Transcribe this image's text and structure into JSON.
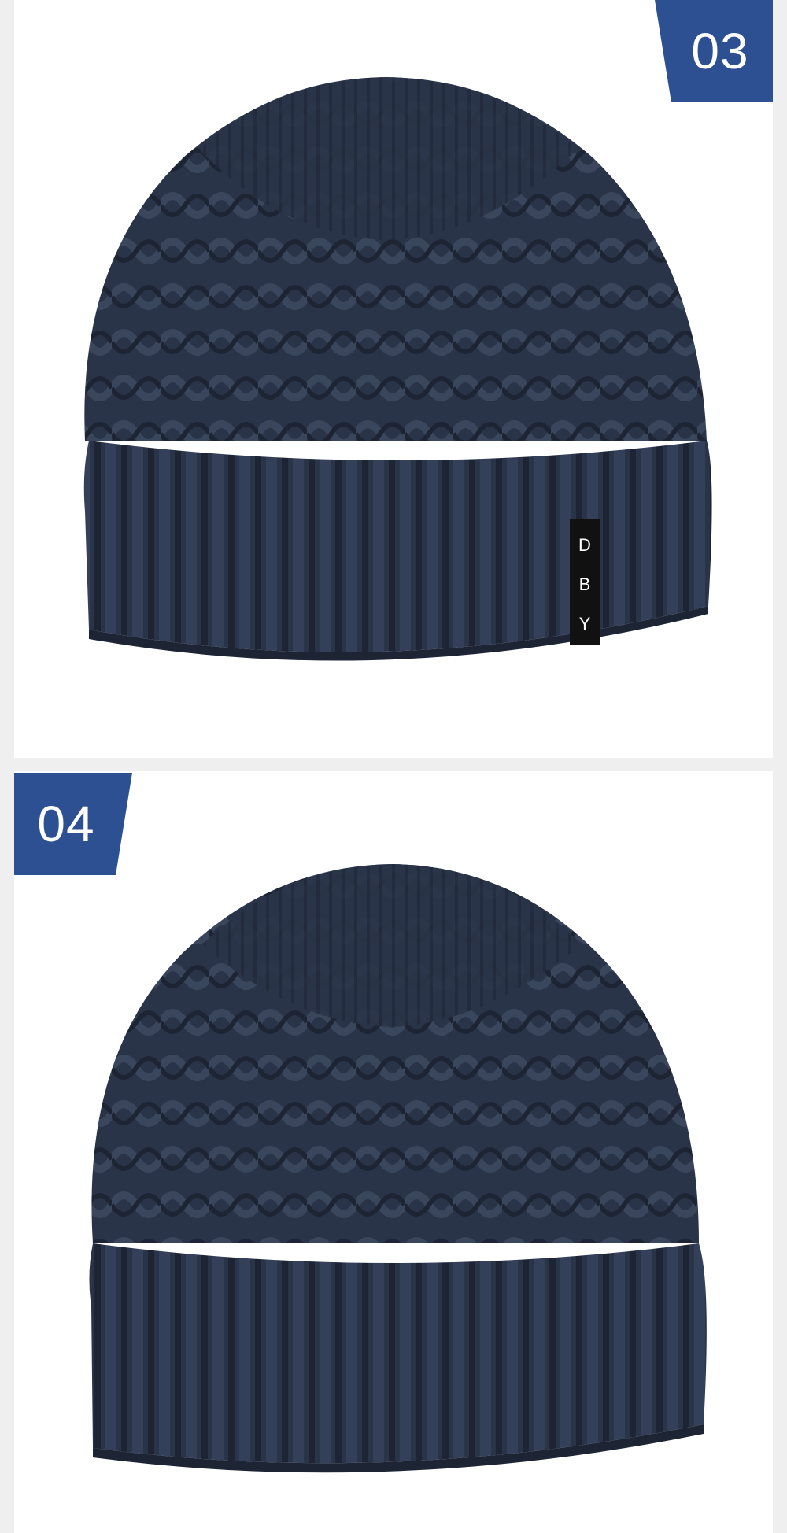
{
  "panels": [
    {
      "badge": "03",
      "label_tag": [
        "D",
        "B",
        "Y"
      ],
      "view": "front"
    },
    {
      "badge": "04",
      "view": "back"
    }
  ],
  "colors": {
    "badge": "#2c5092",
    "hat": "#2a3448",
    "hat_shadow": "#1d2535",
    "hat_highlight": "#3a465c",
    "label": "#111111"
  }
}
